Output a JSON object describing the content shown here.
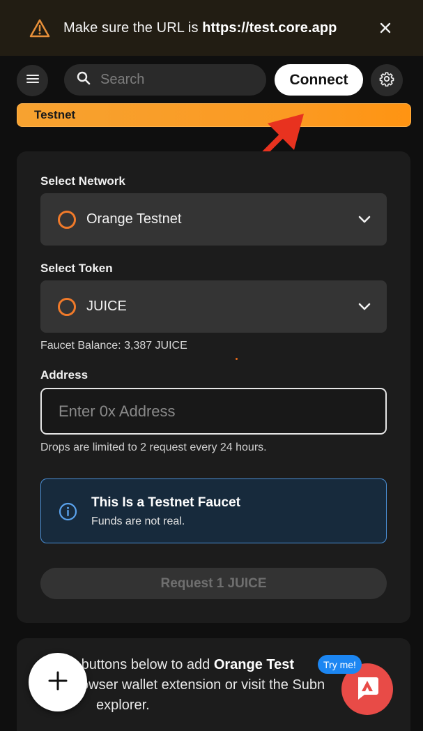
{
  "banner": {
    "message_prefix": "Make sure the URL is ",
    "url": "https://test.core.app"
  },
  "header": {
    "search_placeholder": "Search",
    "connect_label": "Connect"
  },
  "network_strip": {
    "label": "Testnet"
  },
  "faucet": {
    "network_label": "Select Network",
    "network_value": "Orange Testnet",
    "token_label": "Select Token",
    "token_value": "JUICE",
    "balance_text": "Faucet Balance: 3,387 JUICE",
    "address_label": "Address",
    "address_placeholder": "Enter 0x Address",
    "limit_note": "Drops are limited to 2 request every 24 hours.",
    "info_title": "This Is a Testnet Faucet",
    "info_sub": "Funds are not real.",
    "request_label": "Request 1 JUICE"
  },
  "bottom_card": {
    "line1_prefix": "e buttons below to add ",
    "line1_bold": "Orange Test",
    "line2": "owser wallet extension or visit the Subn",
    "line3": "explorer."
  },
  "widget": {
    "tryme_label": "Try me!"
  },
  "colors": {
    "accent_orange": "#f7a230",
    "ring_orange": "#f07a2a",
    "info_blue": "#4a8fd6",
    "annotation_red": "#e8321f",
    "widget_red": "#e84b47",
    "badge_blue": "#1c86f2"
  },
  "icons": {
    "banner": "warning-triangle-icon",
    "close": "close-icon",
    "menu": "hamburger-menu-icon",
    "search": "search-icon",
    "settings": "gear-icon",
    "chevron": "chevron-down-icon",
    "info": "info-icon",
    "fab": "plus-icon"
  }
}
